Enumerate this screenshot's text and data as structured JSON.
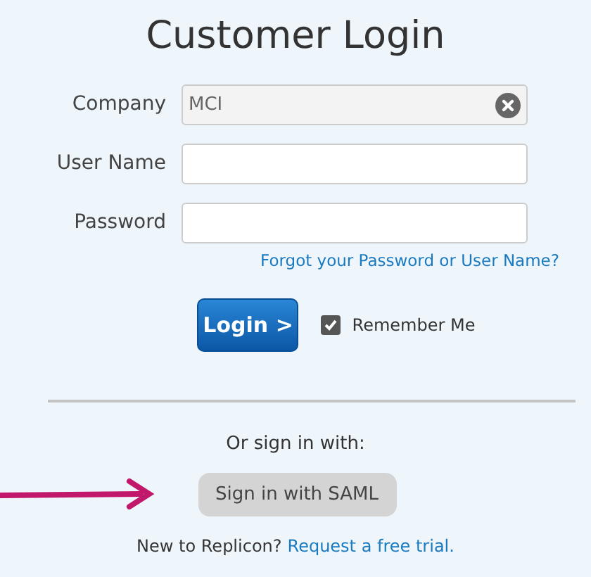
{
  "title": "Customer Login",
  "fields": [
    {
      "label": "Company",
      "value": "MCI",
      "clearable": true,
      "disabled": true
    },
    {
      "label": "User Name",
      "clearable": false,
      "disabled": false
    },
    {
      "label": "Password",
      "clearable": false,
      "disabled": false
    }
  ],
  "forgot_link": "Forgot your Password or User Name?",
  "login_button": "Login >",
  "remember_me": {
    "label": "Remember Me",
    "checked": true
  },
  "alt_heading": "Or sign in with:",
  "saml_button": "Sign in with SAML",
  "footer": {
    "text": "New to Replicon?",
    "link": "Request a free trial."
  }
}
